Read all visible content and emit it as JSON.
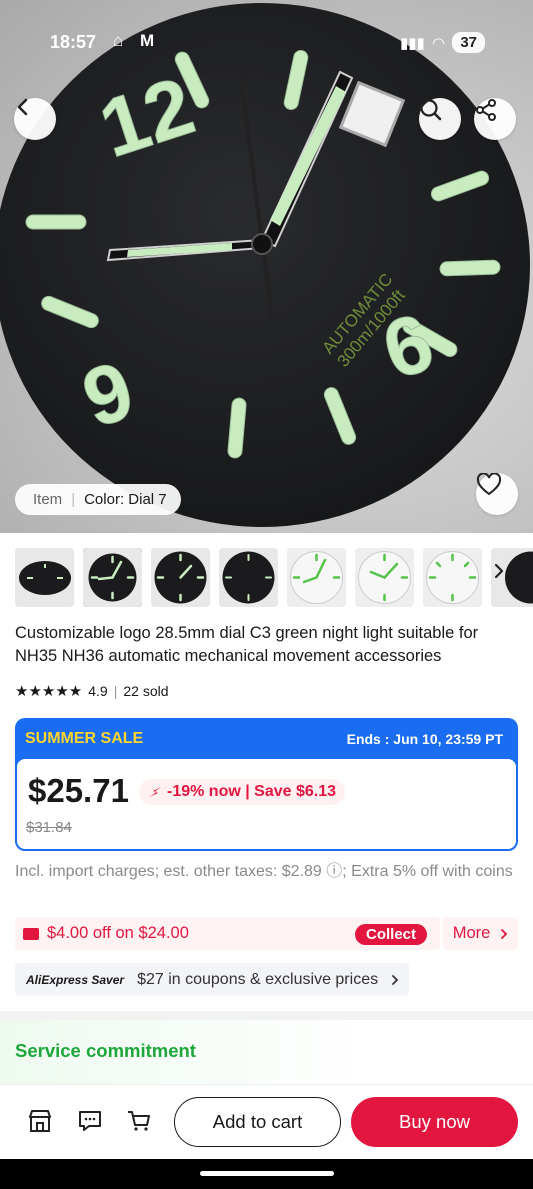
{
  "status_bar": {
    "time": "18:57",
    "battery": "37"
  },
  "hero": {
    "dial_text_line1": "AUTOMATIC",
    "dial_text_line2": "300m/1000ft",
    "numeral_12": "12",
    "numeral_6": "6",
    "numeral_9": "9",
    "variant_chip": {
      "label": "Item",
      "value": "Color: Dial 7"
    }
  },
  "thumbnails": [
    {
      "style": "black-angled"
    },
    {
      "style": "black-front",
      "selected": true
    },
    {
      "style": "black-lume"
    },
    {
      "style": "black-plain"
    },
    {
      "style": "white-green-hands"
    },
    {
      "style": "white-green-hands-2"
    },
    {
      "style": "white-green-markers"
    },
    {
      "style": "partial"
    }
  ],
  "product": {
    "title": "Customizable logo 28.5mm dial C3 green night light suitable for NH35 NH36 automatic mechanical movement accessories",
    "rating": "4.9",
    "sold": "22 sold"
  },
  "sale": {
    "name": "SUMMER SALE",
    "ends": "Ends :  Jun 10, 23:59 PT",
    "price": "$25.71",
    "discount": "-19% now | Save $6.13",
    "original_price": "$31.84"
  },
  "import_note": "Incl. import charges; est. other taxes: $2.89 ⓘ; Extra 5% off with coins",
  "coupon": {
    "text": "$4.00 off on $24.00",
    "collect": "Collect",
    "more": "More"
  },
  "saver": {
    "logo": "AliExpress Saver",
    "text": "$27 in coupons & exclusive prices"
  },
  "service": {
    "title": "Service commitment"
  },
  "bottom_bar": {
    "add_to_cart": "Add to cart",
    "buy_now": "Buy now"
  },
  "colors": {
    "accent_red": "#e3163f",
    "sale_blue": "#1a6cf0",
    "sale_yellow": "#ffd52c",
    "service_green": "#1ea73a",
    "lume_green": "#c8ecc0"
  }
}
